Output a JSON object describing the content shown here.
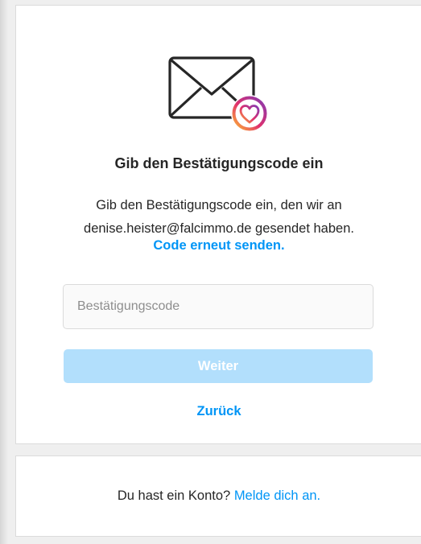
{
  "verification": {
    "icon": "envelope-heart-icon",
    "title": "Gib den Bestätigungscode ein",
    "description": "Gib den Bestätigungscode ein, den wir an denise.heister@falcimmo.de gesendet haben.",
    "resend_label": "Code erneut senden.",
    "code_input": {
      "placeholder": "Bestätigungscode",
      "value": ""
    },
    "next_label": "Weiter",
    "back_label": "Zurück"
  },
  "footer": {
    "prompt": "Du hast ein Konto?",
    "login_link": "Melde dich an."
  },
  "colors": {
    "accent": "#0095f6",
    "button_disabled": "#b2dffc",
    "text": "#262626",
    "border": "#dbdbdb",
    "placeholder": "#8e8e8e"
  }
}
